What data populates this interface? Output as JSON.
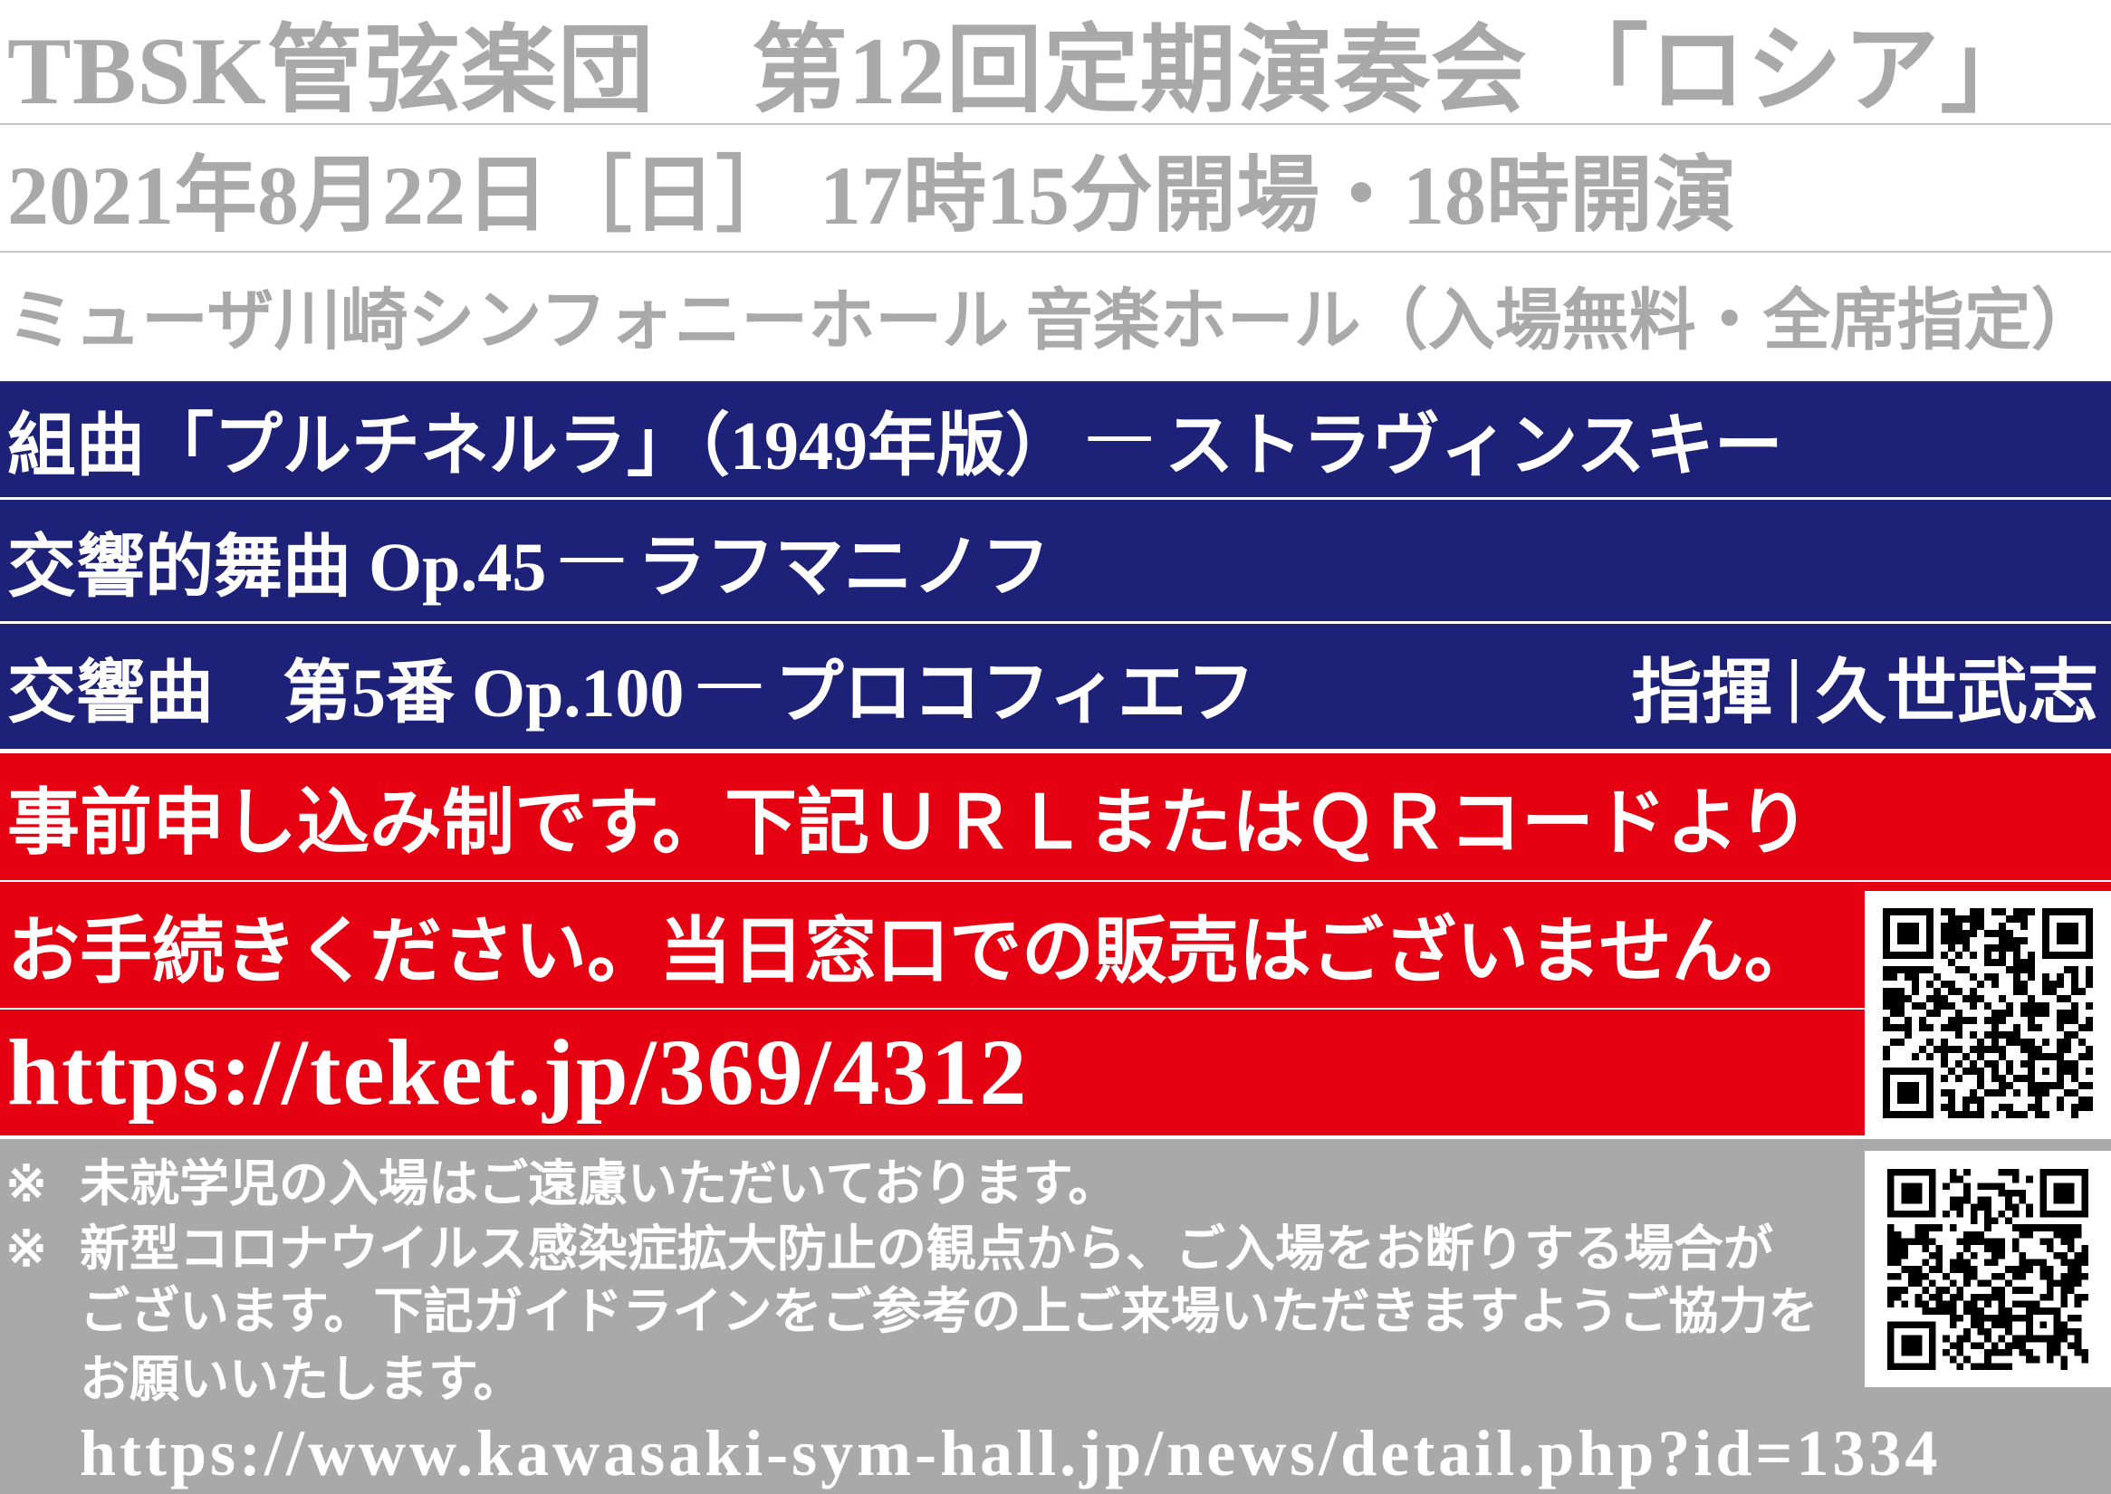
{
  "header": {
    "title": "TBSK管弦楽団　第12回定期演奏会 「ロシア」",
    "datetime": "2021年8月22日［日］ 17時15分開場・18時開演",
    "venue": "ミューザ川崎シンフォニーホール 音楽ホール（入場無料・全席指定）"
  },
  "program": [
    {
      "work": "組曲「プルチネルラ」（1949年版）",
      "dash": "──",
      "composer": "ストラヴィンスキー"
    },
    {
      "work": "交響的舞曲 Op.45",
      "dash": "──",
      "composer": "ラフマニノフ"
    },
    {
      "work": "交響曲　第5番 Op.100",
      "dash": "──",
      "composer": "プロコフィエフ"
    }
  ],
  "conductor": {
    "label": "指揮",
    "separator": "|",
    "name": "久世武志"
  },
  "tickets": {
    "lines": [
      "事前申し込み制です。下記ＵＲＬまたはＱＲコードより",
      "お手続きください。当日窓口での販売はございません。"
    ],
    "url": "https://teket.jp/369/4312"
  },
  "notes": {
    "mark": "※",
    "items": [
      {
        "lines": [
          "未就学児の入場はご遠慮いただいております。"
        ]
      },
      {
        "lines": [
          "新型コロナウイルス感染症拡大防止の観点から、ご入場をお断りする場合が",
          "ございます。下記ガイドラインをご参考の上ご来場いただきますようご協力を",
          "お願いいたします。"
        ]
      }
    ],
    "url": "https://www.kawasaki-sym-hall.jp/news/detail.php?id=1334"
  },
  "icons": [
    "qr-code-icon",
    "qr-code-icon"
  ],
  "colors": {
    "header_text": "#a9a9a9",
    "rule": "#c4c4c4",
    "program_bg": "#1d2178",
    "notice_bg": "#e50012",
    "notes_bg": "#a9a9a9",
    "text_light": "#ffffff"
  }
}
